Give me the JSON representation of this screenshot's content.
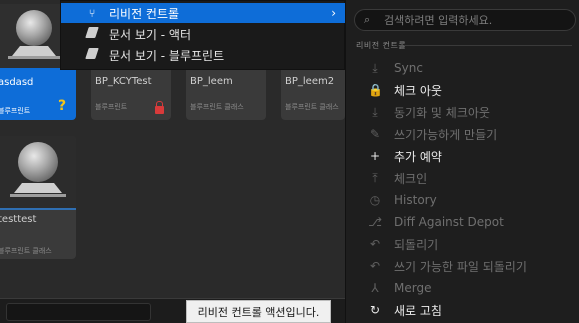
{
  "context_menu": {
    "items": [
      {
        "label": "리비전 컨트롤",
        "icon": "revision-control-icon",
        "submenu_indicator": "›"
      },
      {
        "label": "문서 보기 - 액터",
        "icon": "document-icon"
      },
      {
        "label": "문서 보기 - 블루프린트",
        "icon": "document-icon"
      }
    ]
  },
  "assets": [
    {
      "name": "asdasd",
      "type": "블루프린트",
      "badge": "?"
    },
    {
      "name": "BP_KCYTest",
      "type": "블루프린트"
    },
    {
      "name": "BP_leem",
      "type": "블루프린트 클래스"
    },
    {
      "name": "BP_leem2",
      "type": "블루프린트 클래스"
    },
    {
      "name": "testtest",
      "type": "블루프린트 클래스"
    }
  ],
  "submenu": {
    "search_placeholder": "검색하려면 입력하세요.",
    "section_label": "리비전 컨트롤",
    "items": [
      {
        "label": "Sync",
        "icon": "sync-icon",
        "glyph": "⤓",
        "enabled": false
      },
      {
        "label": "체크 아웃",
        "icon": "lock-icon",
        "glyph": "🔒",
        "enabled": true
      },
      {
        "label": "동기화 및 체크아웃",
        "icon": "sync-checkout-icon",
        "glyph": "⤓",
        "enabled": false
      },
      {
        "label": "쓰기가능하게 만들기",
        "icon": "pencil-icon",
        "glyph": "✎",
        "enabled": false
      },
      {
        "label": "추가 예약",
        "icon": "plus-icon",
        "glyph": "+",
        "enabled": true
      },
      {
        "label": "체크인",
        "icon": "checkin-icon",
        "glyph": "⤒",
        "enabled": false
      },
      {
        "label": "History",
        "icon": "history-icon",
        "glyph": "◷",
        "enabled": false
      },
      {
        "label": "Diff Against Depot",
        "icon": "diff-icon",
        "glyph": "⎇",
        "enabled": false
      },
      {
        "label": "되돌리기",
        "icon": "revert-icon",
        "glyph": "↶",
        "enabled": false
      },
      {
        "label": "쓰기 가능한 파일 되돌리기",
        "icon": "revert-writable-icon",
        "glyph": "↶",
        "enabled": false
      },
      {
        "label": "Merge",
        "icon": "merge-icon",
        "glyph": "⅄",
        "enabled": false
      },
      {
        "label": "새로 고침",
        "icon": "refresh-icon",
        "glyph": "↻",
        "enabled": true
      }
    ]
  },
  "tooltip": {
    "text": "리비전 컨트롤 액션입니다."
  },
  "colors": {
    "selection": "#0e6dd8",
    "warning": "#f5c518",
    "lock_badge": "#d83a3a"
  }
}
